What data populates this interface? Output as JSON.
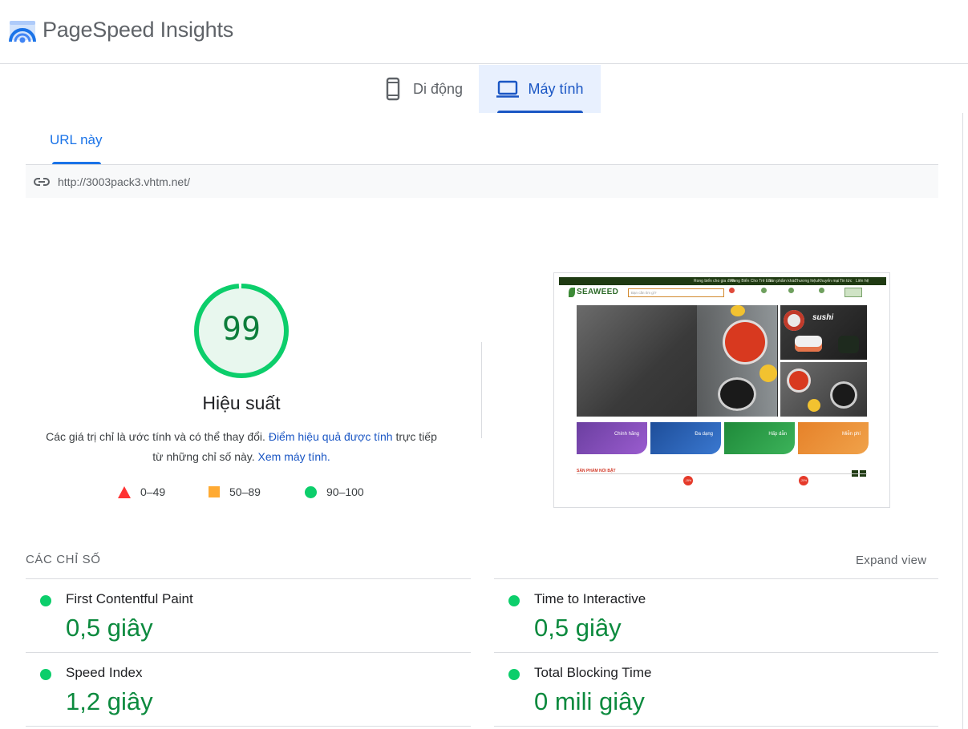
{
  "app": {
    "title": "PageSpeed Insights"
  },
  "device_tabs": [
    {
      "label": "Di động",
      "icon": "smartphone-icon",
      "selected": false
    },
    {
      "label": "Máy tính",
      "icon": "laptop-icon",
      "selected": true
    }
  ],
  "url_tab": {
    "label": "URL này"
  },
  "url": {
    "value": "http://3003pack3.vhtm.net/"
  },
  "score": {
    "value": "99",
    "label": "Hiệu suất",
    "color": "#0cce6b",
    "fill": 0.99
  },
  "description": {
    "part1": "Các giá trị chỉ là ước tính và có thể thay đổi. ",
    "link1": "Điểm hiệu quả được tính",
    "part2": " trực tiếp từ những chỉ số này. ",
    "link2": "Xem máy tính."
  },
  "legend": [
    {
      "range": "0–49",
      "shape": "triangle",
      "color": "#ff3333"
    },
    {
      "range": "50–89",
      "shape": "square",
      "color": "#ffaa33"
    },
    {
      "range": "90–100",
      "shape": "circle",
      "color": "#0cce6b"
    }
  ],
  "thumbnail": {
    "brand": "SEAWEED",
    "search_placeholder": "Bạn cần tìm gì?",
    "topbar_links": [
      "Rong biển cho gia đình",
      "Rong Biển Cho Trẻ Em",
      "Sản phẩm khác",
      "Thương hiệu",
      "Khuyến mại",
      "Tin tức",
      "Liên hệ"
    ],
    "hero_label": "sushi",
    "cards": [
      "Chính hãng",
      "Đa dạng",
      "Hấp dẫn",
      "Miễn phí"
    ],
    "section_heading": "SẢN PHẨM NỔI BẬT",
    "badges": [
      "-15%",
      "-20%"
    ]
  },
  "metrics": {
    "title": "CÁC CHỈ SỐ",
    "expand_label": "Expand view",
    "items": [
      {
        "name": "First Contentful Paint",
        "value": "0,5 giây"
      },
      {
        "name": "Time to Interactive",
        "value": "0,5 giây"
      },
      {
        "name": "Speed Index",
        "value": "1,2 giây"
      },
      {
        "name": "Total Blocking Time",
        "value": "0 mili giây"
      }
    ]
  }
}
